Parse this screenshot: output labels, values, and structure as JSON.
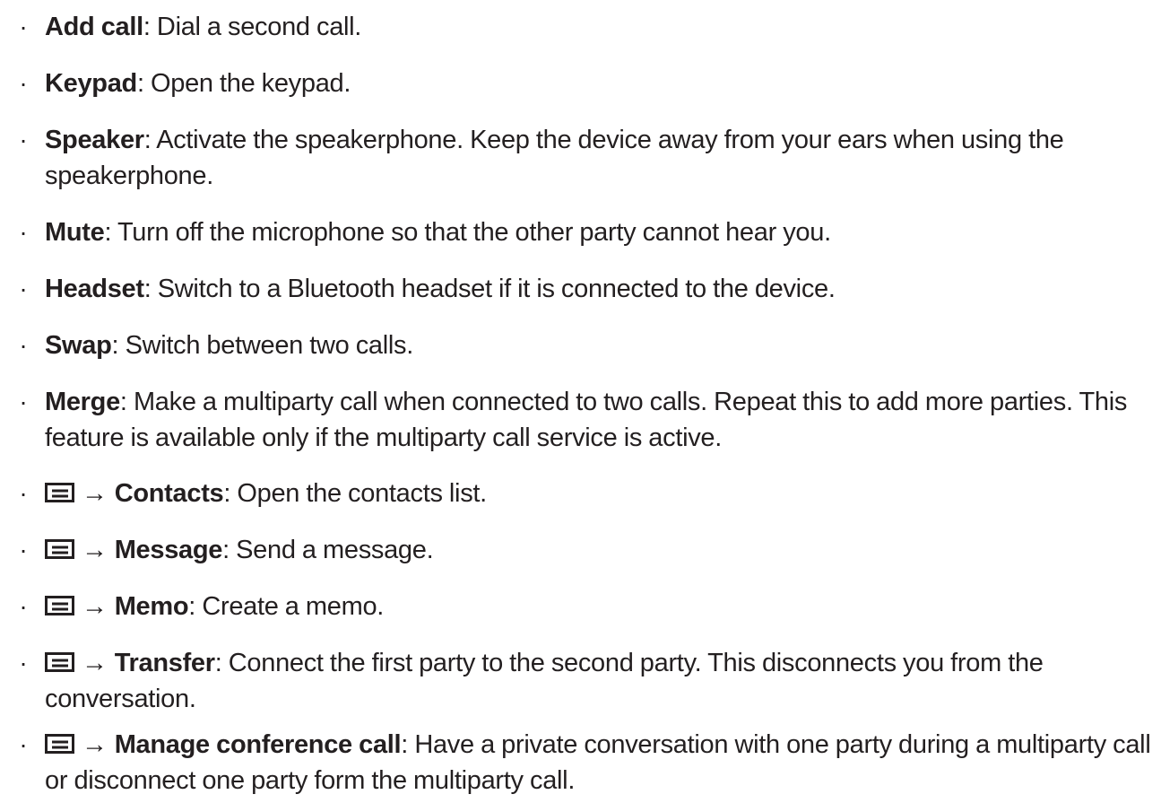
{
  "items": [
    {
      "term": "Add call",
      "sep": ": ",
      "desc": "Dial a second call."
    },
    {
      "term": "Keypad",
      "sep": ": ",
      "desc": "Open the keypad."
    },
    {
      "term": "Speaker",
      "sep": ": ",
      "desc": "Activate the speakerphone. Keep the device away from your ears when using the speakerphone."
    },
    {
      "term": "Mute",
      "sep": ": ",
      "desc": "Turn off the microphone so that the other party cannot hear you."
    },
    {
      "term": "Headset",
      "sep": ": ",
      "desc": "Switch to a Bluetooth headset if it is connected to the device."
    },
    {
      "term": "Swap",
      "sep": ": ",
      "desc": "Switch between two calls."
    },
    {
      "term": "Merge",
      "sep": ": ",
      "desc": "Make a multiparty call when connected to two calls. Repeat this to add more parties. This feature is available only if the multiparty call service is active."
    },
    {
      "icon": "menu-key-icon",
      "arrow": "→",
      "term": "Contacts",
      "sep": ": ",
      "desc": "Open the contacts list."
    },
    {
      "icon": "menu-key-icon",
      "arrow": "→",
      "term": "Message",
      "sep": ": ",
      "desc": "Send a message."
    },
    {
      "icon": "menu-key-icon",
      "arrow": "→",
      "term": "Memo",
      "sep": ": ",
      "desc": "Create a memo."
    },
    {
      "icon": "menu-key-icon",
      "arrow": "→",
      "term": "Transfer",
      "sep": ": ",
      "desc": "Connect the first party to the second party. This disconnects you from the conversation."
    },
    {
      "icon": "menu-key-icon",
      "arrow": "→",
      "term": "Manage conference call",
      "sep": ": ",
      "desc": "Have a private conversation with one party during a multiparty call or disconnect one party form the multiparty call."
    }
  ],
  "bullet_char": "·",
  "colors": {
    "text": "#231f20",
    "background": "#ffffff"
  }
}
